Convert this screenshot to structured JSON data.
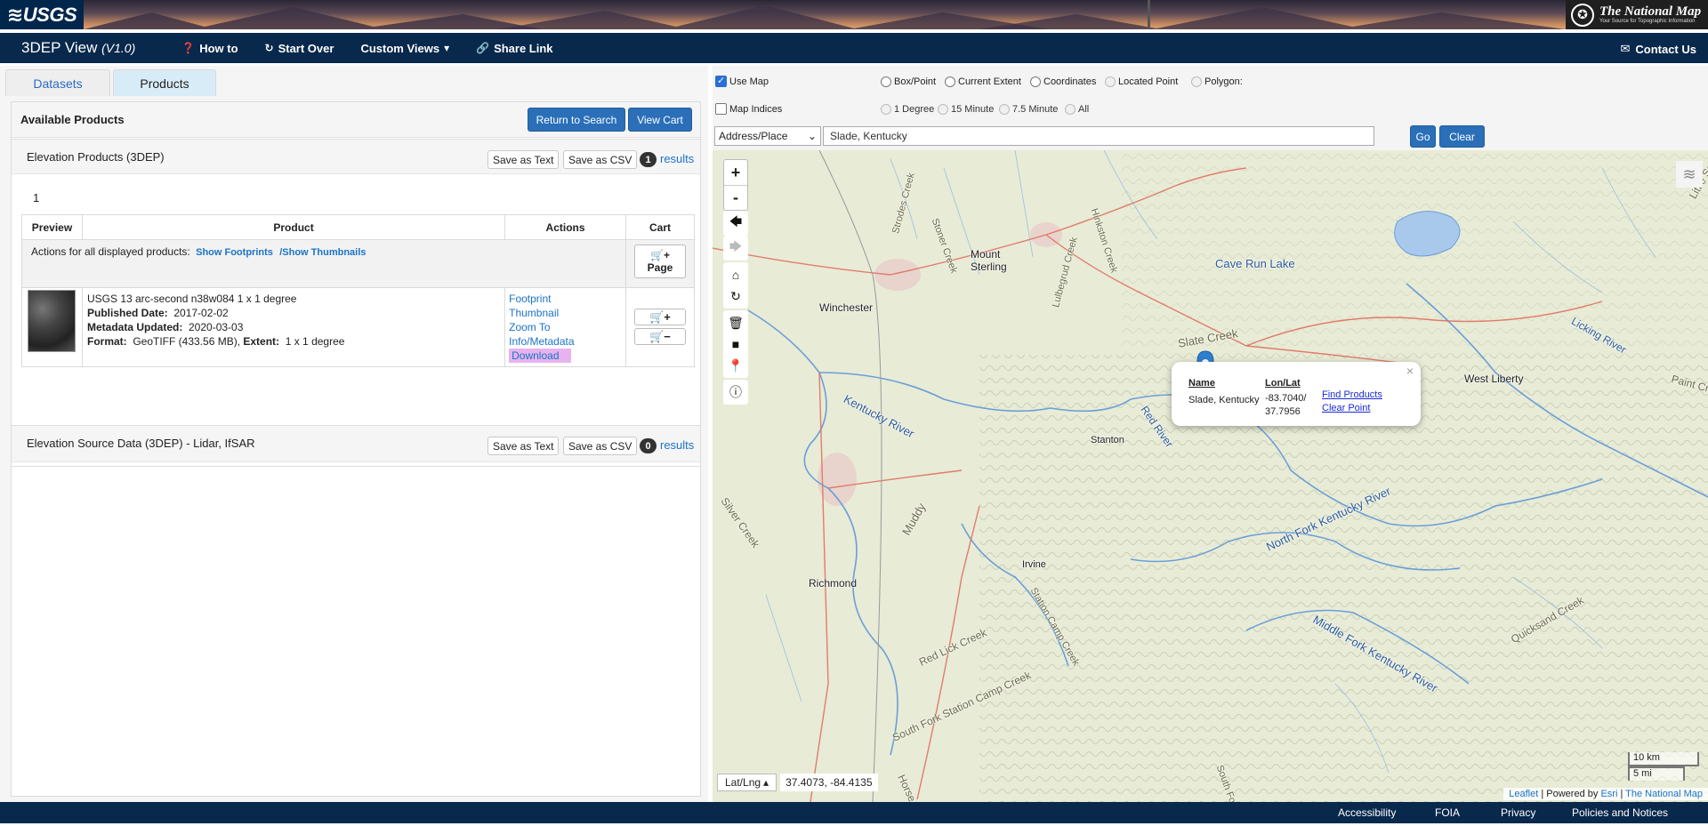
{
  "banner": {
    "usgs_logo": "≋USGS",
    "tnm_title": "The National Map",
    "tnm_subtitle": "Your Source for Topographic Information"
  },
  "navbar": {
    "brand": "3DEP View",
    "version": "(V1.0)",
    "how_to": "How to",
    "start_over": "Start Over",
    "custom_views": "Custom Views",
    "share_link": "Share Link",
    "contact_us": "Contact Us"
  },
  "tabs": {
    "datasets": "Datasets",
    "products": "Products"
  },
  "available": {
    "heading": "Available Products",
    "return_button": "Return to Search",
    "view_cart_button": "View Cart"
  },
  "elevation_products": {
    "title": "Elevation Products (3DEP)",
    "save_text": "Save as Text",
    "save_csv": "Save as CSV",
    "count": "1",
    "results_label": "results",
    "page_number": "1",
    "columns": [
      "Preview",
      "Product",
      "Actions",
      "Cart"
    ],
    "actions_all_label": "Actions for all displayed products:",
    "show_footprints": "Show Footprints",
    "show_thumbnails": "/Show Thumbnails",
    "page_button": "Page",
    "product": {
      "title": "USGS 13 arc-second n38w084 1 x 1 degree",
      "published_label": "Published Date:",
      "published_value": "2017-02-02",
      "metadata_label": "Metadata Updated:",
      "metadata_value": "2020-03-03",
      "format_label": "Format:",
      "format_value": "GeoTIFF (433.56 MB),",
      "extent_label": "Extent:",
      "extent_value": "1 x 1 degree",
      "actions": [
        "Footprint",
        "Thumbnail",
        "Zoom To",
        "Info/Metadata",
        "Download"
      ]
    }
  },
  "source_data": {
    "title": "Elevation Source Data (3DEP) - Lidar, IfSAR",
    "save_text": "Save as Text",
    "save_csv": "Save as CSV",
    "count": "0",
    "results_label": "results"
  },
  "map_controls": {
    "use_map": "Use Map",
    "map_indices": "Map Indices",
    "box_point": "Box/Point",
    "current_extent": "Current Extent",
    "coordinates": "Coordinates",
    "located_point": "Located Point",
    "polygon": "Polygon:",
    "one_degree": "1 Degree",
    "fifteen_minute": "15 Minute",
    "seven_five_minute": "7.5 Minute",
    "all": "All",
    "search_type": "Address/Place",
    "search_value": "Slade, Kentucky",
    "go": "Go",
    "clear": "Clear"
  },
  "map": {
    "zoom_in": "+",
    "zoom_out": "-",
    "popup": {
      "name_header": "Name",
      "lonlat_header": "Lon/Lat",
      "name": "Slade, Kentucky",
      "lon": "-83.7040/",
      "lat": "37.7956",
      "find_products": "Find Products",
      "clear_point": "Clear Point",
      "close": "×"
    },
    "coord_mode": "Lat/Lng",
    "coord_value": "37.4073, -84.4135",
    "scale_km": "10 km",
    "scale_mi": "5 mi",
    "attribution": {
      "leaflet": "Leaflet",
      "powered": "| Powered by",
      "esri": "Esri",
      "sep": "|",
      "tnm": "The National Map"
    },
    "labels": [
      "Winchester",
      "Mount",
      "Sterling",
      "Cave Run Lake",
      "Slate Creek",
      "West Liberty",
      "Stanton",
      "Kentucky River",
      "Red River",
      "Irvine",
      "Richmond",
      "Muddy",
      "North Fork Kentucky River",
      "Middle Fork Kentucky River",
      "Licking River",
      "Silver Creek",
      "Red Lick Creek",
      "Station Camp Creek",
      "South Fork Station Camp Creek",
      "Quicksand Creek",
      "Hinkston Creek",
      "Stoner Creek",
      "Strodes Creek",
      "Lulbegrud Creek",
      "Paint Cr",
      "Little Sandy",
      "Horse Lick Creek",
      "South Fork"
    ]
  },
  "footer": {
    "accessibility": "Accessibility",
    "foia": "FOIA",
    "privacy": "Privacy",
    "policies": "Policies and Notices"
  },
  "colors": {
    "navbar": "#08284c",
    "accent_blue": "#2a6fb8",
    "link": "#1a73c9",
    "map_base": "#e9ecd7",
    "river": "#6a9fd8",
    "road": "#e07060",
    "pin": "#2f7fd0"
  }
}
